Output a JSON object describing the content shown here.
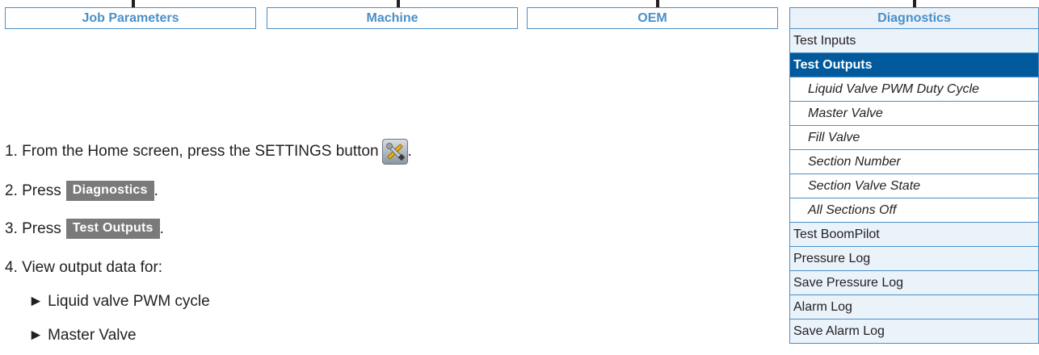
{
  "tabs": [
    {
      "label": "Job Parameters"
    },
    {
      "label": "Machine"
    },
    {
      "label": "OEM"
    },
    {
      "label": "Diagnostics"
    }
  ],
  "menu": {
    "items": [
      {
        "label": "Test Inputs",
        "type": "item"
      },
      {
        "label": "Test Outputs",
        "type": "selected"
      },
      {
        "label": "Liquid Valve PWM Duty Cycle",
        "type": "sub"
      },
      {
        "label": "Master Valve",
        "type": "sub"
      },
      {
        "label": "Fill Valve",
        "type": "sub"
      },
      {
        "label": "Section Number",
        "type": "sub"
      },
      {
        "label": "Section Valve State",
        "type": "sub"
      },
      {
        "label": "All Sections Off",
        "type": "sub"
      },
      {
        "label": "Test BoomPilot",
        "type": "item"
      },
      {
        "label": "Pressure Log",
        "type": "item"
      },
      {
        "label": "Save Pressure Log",
        "type": "item"
      },
      {
        "label": "Alarm Log",
        "type": "item"
      },
      {
        "label": "Save Alarm Log",
        "type": "item"
      }
    ]
  },
  "steps": {
    "s1_text": "1. From the Home screen, press the SETTINGS button",
    "s1_end": ".",
    "s2_text": "2. Press",
    "s2_chip": "Diagnostics",
    "s2_end": ".",
    "s3_text": "3. Press",
    "s3_chip": "Test Outputs",
    "s3_end": ".",
    "s4_text": "4. View output data for:",
    "bullets": [
      "► Liquid valve PWM cycle",
      "► Master Valve"
    ]
  },
  "icons": {
    "settings": "settings-tools-icon"
  },
  "colors": {
    "accent": "#4a90c8",
    "selected": "#005a9c",
    "chip": "#7a7a7a"
  }
}
